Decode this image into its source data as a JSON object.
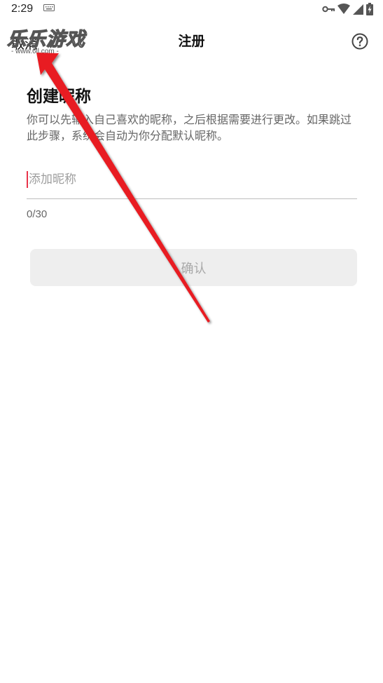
{
  "status_bar": {
    "time": "2:29",
    "icons": [
      "keyboard-icon",
      "vpn-key-icon",
      "wifi-icon",
      "signal-icon",
      "battery-icon"
    ]
  },
  "app_bar": {
    "back_label": "取消",
    "title": "注册",
    "help_icon": "help-circle-icon"
  },
  "watermark": {
    "title": "乐乐游戏",
    "url": "- www.6ll.com -"
  },
  "form": {
    "heading": "创建昵称",
    "description": "你可以先输入自己喜欢的昵称，之后根据需要进行更改。如果跳过此步骤，系统会自动为你分配默认昵称。",
    "nickname_value": "",
    "nickname_placeholder": "添加昵称",
    "char_counter": "0/30",
    "confirm_label": "确认"
  },
  "colors": {
    "caret": "#e8344a",
    "arrow": "#e81f24",
    "button_bg": "#eeeeee",
    "button_text_disabled": "#a8a8a8"
  }
}
